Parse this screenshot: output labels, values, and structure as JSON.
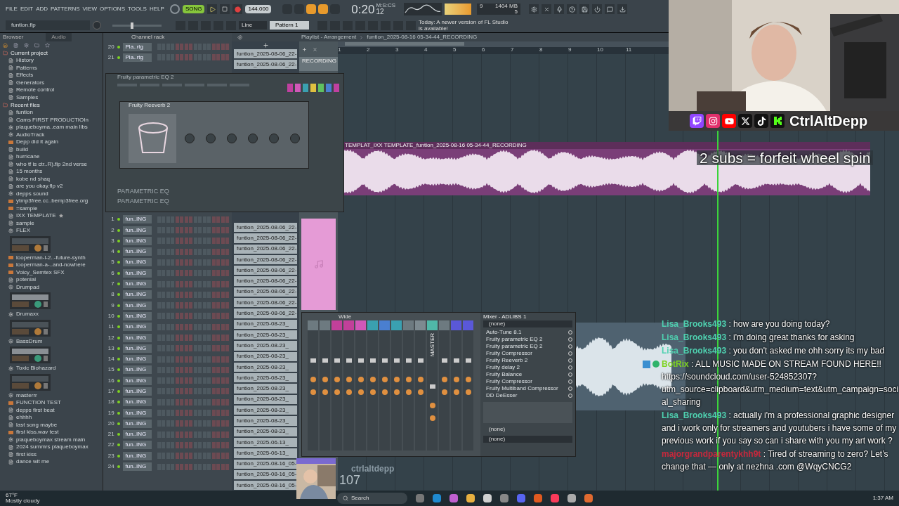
{
  "menu": [
    "FILE",
    "EDIT",
    "ADD",
    "PATTERNS",
    "VIEW",
    "OPTIONS",
    "TOOLS",
    "HELP"
  ],
  "transport": {
    "mode": "SONG",
    "playing": false,
    "tempo": "144.000",
    "time": "0:20",
    "time_small": "12",
    "time_unit": "M:S:CS",
    "memory": "1404 MB",
    "voices": "9",
    "cpu": "5"
  },
  "project_file": "funtion.flp",
  "master_pitch": {
    "level": 0.4
  },
  "snap": "Line",
  "pattern": "Pattern 1",
  "hint": "Today: A newer version of FL Studio is available!",
  "browser": {
    "title": "Browser",
    "filter": "Audio",
    "sections": [
      {
        "label": "Current project",
        "children": [
          {
            "label": "History"
          },
          {
            "label": "Patterns"
          },
          {
            "label": "Effects"
          },
          {
            "label": "Generators"
          },
          {
            "label": "Remote control"
          },
          {
            "label": "Samples"
          }
        ]
      },
      {
        "label": "Recent files",
        "children": [
          {
            "label": "funtion",
            "kind": "file"
          },
          {
            "label": "Cams FIRST PRODUCTIOIn",
            "kind": "file"
          },
          {
            "label": "plaqueboyma..eam main libs",
            "kind": "plugin"
          },
          {
            "label": "AudioTrack",
            "kind": "plugin"
          },
          {
            "label": "Depp did it again",
            "kind": "audio"
          },
          {
            "label": "build",
            "kind": "file"
          },
          {
            "label": "hurricane",
            "kind": "file"
          },
          {
            "label": "who tf is ctr..R).flp 2nd verse",
            "kind": "file"
          },
          {
            "label": "15 months",
            "kind": "file"
          },
          {
            "label": "kobe nd shaq",
            "kind": "file"
          },
          {
            "label": "are you okay.flp v2",
            "kind": "file"
          },
          {
            "label": "depps sound",
            "kind": "plugin"
          },
          {
            "label": "ytmp3free.cc..bemp3free.org",
            "kind": "audio"
          },
          {
            "label": "=sample",
            "kind": "audio"
          },
          {
            "label": "IXX TEMPLATE",
            "kind": "file",
            "starred": true
          },
          {
            "label": "sample",
            "kind": "file"
          },
          {
            "label": "FLEX",
            "kind": "plugin",
            "thumbnail": true
          },
          {
            "label": "looperman-l-2..-future-synth",
            "kind": "audio"
          },
          {
            "label": "looperman-a-..and-nowhere",
            "kind": "audio"
          },
          {
            "label": "Voicy_Semtex SFX",
            "kind": "audio"
          },
          {
            "label": "potenial",
            "kind": "file"
          },
          {
            "label": "Drumpad",
            "kind": "plugin",
            "thumbnail": true
          },
          {
            "label": "Drumaxx",
            "kind": "plugin",
            "thumbnail": true
          },
          {
            "label": "BassDrum",
            "kind": "plugin",
            "thumbnail": true
          },
          {
            "label": "Toxic Biohazard",
            "kind": "plugin",
            "thumbnail": true
          },
          {
            "label": "masterrr",
            "kind": "plugin"
          },
          {
            "label": "FUNCTION TEST",
            "kind": "audio"
          },
          {
            "label": "depps first beat",
            "kind": "file"
          },
          {
            "label": "ehhhh",
            "kind": "file"
          },
          {
            "label": "last song maybe",
            "kind": "file"
          },
          {
            "label": "first kiss.wav test",
            "kind": "audio"
          },
          {
            "label": "plaqueboymax stream main",
            "kind": "plugin"
          },
          {
            "label": "2024 summrs plaqueboymax",
            "kind": "file"
          },
          {
            "label": "first kiss",
            "kind": "file"
          },
          {
            "label": "dance wit me",
            "kind": "file"
          }
        ]
      }
    ]
  },
  "channel_rack": {
    "title": "Channel rack",
    "top_channels": [
      {
        "number": "20",
        "name": "Pla..rtg"
      },
      {
        "number": "21",
        "name": "Pla..rtg"
      }
    ],
    "channels": [
      {
        "number": "1",
        "name": "fun..ING"
      },
      {
        "number": "2",
        "name": "fun..ING"
      },
      {
        "number": "3",
        "name": "fun..ING"
      },
      {
        "number": "4",
        "name": "fun..ING"
      },
      {
        "number": "5",
        "name": "fun..ING"
      },
      {
        "number": "6",
        "name": "fun..ING"
      },
      {
        "number": "7",
        "name": "fun..ING"
      },
      {
        "number": "8",
        "name": "fun..ING"
      },
      {
        "number": "9",
        "name": "fun..ING"
      },
      {
        "number": "10",
        "name": "fun..ING"
      },
      {
        "number": "11",
        "name": "fun..ING"
      },
      {
        "number": "12",
        "name": "fun..ING"
      },
      {
        "number": "13",
        "name": "fun..ING"
      },
      {
        "number": "14",
        "name": "fun..ING"
      },
      {
        "number": "15",
        "name": "fun..ING"
      },
      {
        "number": "16",
        "name": "fun..ING"
      },
      {
        "number": "17",
        "name": "fun..ING"
      },
      {
        "number": "18",
        "name": "fun..ING"
      },
      {
        "number": "19",
        "name": "fun..ING"
      },
      {
        "number": "20",
        "name": "fun..ING"
      },
      {
        "number": "21",
        "name": "fun..ING"
      },
      {
        "number": "22",
        "name": "fun..ING"
      },
      {
        "number": "23",
        "name": "fun..ING"
      },
      {
        "number": "24",
        "name": "fun..ING"
      }
    ]
  },
  "plugins": [
    {
      "title": "Fruity parametric EQ 2",
      "label": "PARAMETRIC EQ"
    },
    {
      "title": "Fruity Reeverb 2",
      "label": "PARAMETRIC EQ"
    }
  ],
  "playlist": {
    "title": "Playlist - Arrangement",
    "path": "funtion_2025-08-16 05-34-44_RECORDING",
    "bars": [
      "1",
      "2",
      "3",
      "4",
      "5",
      "6",
      "7",
      "8",
      "9",
      "10",
      "11"
    ],
    "track_name": "RECORDING",
    "top_clips": [
      "funtion_2025-08-06_22-",
      "funtion_2025-08-06_22-"
    ],
    "clips": [
      "funtion_2025-08-06_22-",
      "funtion_2025-08-06_22-",
      "funtion_2025-08-06_22-",
      "funtion_2025-08-06_22-",
      "funtion_2025-08-06_22-",
      "funtion_2025-08-06_22-",
      "funtion_2025-08-06_22-",
      "funtion_2025-08-06_22-",
      "funtion_2025-08-06_22-",
      "funtion_2025-08-23_",
      "funtion_2025-08-23_",
      "funtion_2025-08-23_",
      "funtion_2025-08-23_",
      "funtion_2025-08-23_",
      "funtion_2025-08-23_",
      "funtion_2025-08-23_",
      "funtion_2025-08-23_",
      "funtion_2025-08-23_",
      "funtion_2025-08-23_",
      "funtion_2025-08-23_",
      "funtion_2025-06-13_",
      "funtion_2025-06-13_",
      "funtion_2025-08-16_05-",
      "funtion_2025-08-16_05-",
      "funtion_2025-08-16_05-"
    ],
    "audio_clip_title": "TEMPLAT_IXX TEMPLATE_funtion_2025-08-16 05-34-44_RECORDING"
  },
  "mixer": {
    "title": "Mixer - ADLIBS 1",
    "view": "Wide",
    "input": "(none)",
    "slots": [
      "Auto-Tune 8.1",
      "Fruity parametric EQ 2",
      "Fruity parametric EQ 2",
      "Fruity Compressor",
      "Fruity Reeverb 2",
      "Fruity delay 2",
      "Fruity Balance",
      "Fruity Compressor",
      "Fruity Multiband Compressor",
      "DD DeEsser"
    ],
    "sidechain": "(none)",
    "output": "(none)",
    "strips": [
      {
        "color": "#6d7a80"
      },
      {
        "color": "#6d7a80"
      },
      {
        "color": "#c2409a"
      },
      {
        "color": "#c2409a"
      },
      {
        "color": "#d058b8"
      },
      {
        "color": "#3aa0b0"
      },
      {
        "color": "#4a7fd0"
      },
      {
        "color": "#3aa0b0"
      },
      {
        "color": "#6d7a80"
      },
      {
        "color": "#7d8a90"
      },
      {
        "color": "#50b8a8",
        "label": "MASTER"
      },
      {
        "color": "#6d7a80"
      },
      {
        "color": "#5a58d8"
      },
      {
        "color": "#5a58d8"
      }
    ]
  },
  "stream": {
    "separator": ":",
    "banner": "2 subs = forfeit wheel spin",
    "handle": "CtrlAltDepp",
    "viewer_name": "ctrlaltdepp",
    "viewer_count": "107",
    "chat": [
      {
        "user": "Lisa_Brooks493",
        "color": "#4fd1b0",
        "text": "how are you doing today?"
      },
      {
        "user": "Lisa_Brooks493",
        "color": "#4fd1b0",
        "text": "i'm doing great thanks for asking"
      },
      {
        "user": "Lisa_Brooks493",
        "color": "#4fd1b0",
        "text": "you don't asked me ohh sorry its my bad"
      },
      {
        "user": "BotRix",
        "color": "#7ed321",
        "kind": "bot",
        "text": "ALL MUSIC MADE ON STREAM FOUND HERE!! https://soundcloud.com/user-524852307?utm_source=clipboard&utm_medium=text&utm_campaign=social_sharing"
      },
      {
        "user": "Lisa_Brooks493",
        "color": "#4fd1b0",
        "text": "actually i'm a professional graphic designer and i work only for streamers and youtubers i have some of my previous work if you say so can i share with you my art work ?"
      },
      {
        "user": "majorgrandparentykhh9t",
        "color": "#c8283c",
        "text": "Tired of streaming to zero? Let’s change that — only at nezhna .com @WqyCNCG2"
      }
    ]
  },
  "taskbar": {
    "weather_temp": "67°F",
    "weather_text": "Mostly cloudy",
    "search": "Search",
    "clock": "1:37 AM"
  }
}
